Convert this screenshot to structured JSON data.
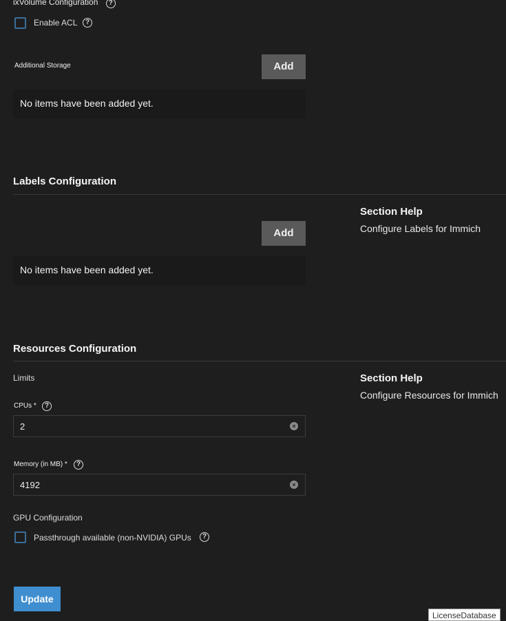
{
  "ixvolume": {
    "title": "ixVolume Configuration",
    "enable_acl": "Enable ACL"
  },
  "storage": {
    "label": "Additional Storage",
    "add": "Add",
    "empty": "No items have been added yet."
  },
  "labels": {
    "title": "Labels Configuration",
    "add": "Add",
    "empty": "No items have been added yet.",
    "help_title": "Section Help",
    "help_text": "Configure Labels for Immich"
  },
  "resources": {
    "title": "Resources Configuration",
    "limits": "Limits",
    "cpus_label": "CPUs *",
    "cpus_value": "2",
    "memory_label": "Memory (in MB) *",
    "memory_value": "4192",
    "help_title": "Section Help",
    "help_text": "Configure Resources for Immich",
    "gpu_title": "GPU Configuration",
    "gpu_passthrough": "Passthrough available (non-NVIDIA) GPUs"
  },
  "update": "Update",
  "tooltip": "LicenseDatabase"
}
